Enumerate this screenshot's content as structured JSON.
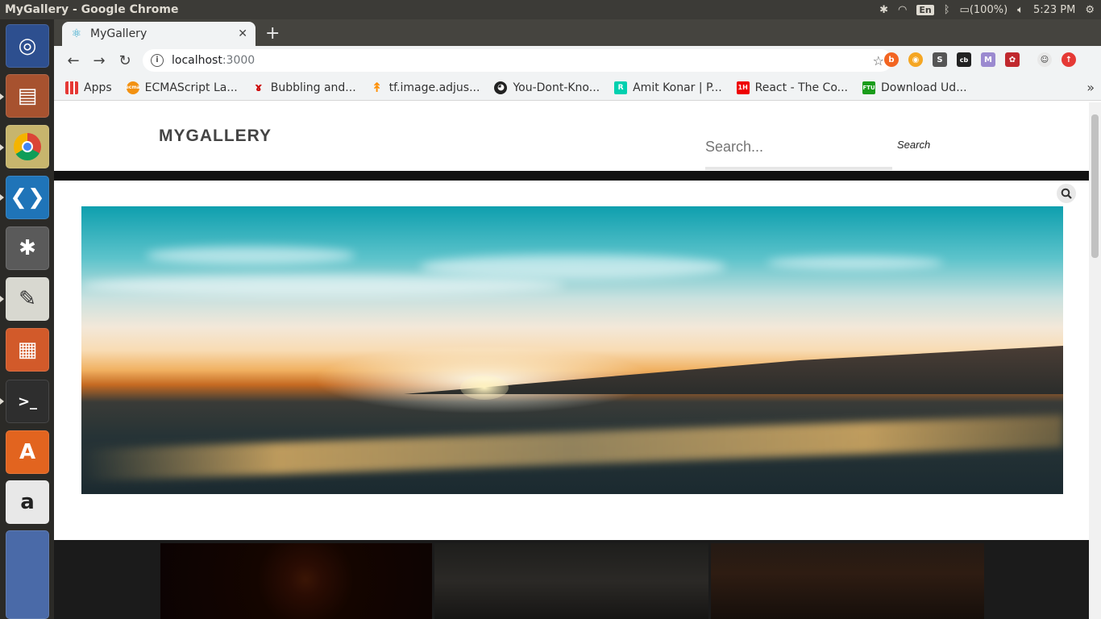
{
  "os": {
    "window_title": "MyGallery - Google Chrome",
    "keyboard_layout": "En",
    "battery": "(100%)",
    "clock": "5:23 PM"
  },
  "browser": {
    "tab": {
      "title": "MyGallery",
      "favicon": "react-icon"
    },
    "url": {
      "host": "localhost",
      "port": ":3000"
    },
    "bookmarks": [
      {
        "label": "Apps",
        "icon": "apps-grid-icon"
      },
      {
        "label": "ECMAScript La...",
        "icon": "ecma-icon"
      },
      {
        "label": "Bubbling and...",
        "icon": "person-icon"
      },
      {
        "label": "tf.image.adjus...",
        "icon": "tensorflow-icon"
      },
      {
        "label": "You-Dont-Kno...",
        "icon": "github-icon"
      },
      {
        "label": "Amit Konar | P...",
        "icon": "researchgate-icon"
      },
      {
        "label": "React - The Co...",
        "icon": "react-icon"
      },
      {
        "label": "Download Ud...",
        "icon": "ftu-icon"
      }
    ]
  },
  "site": {
    "brand": "MYGALLERY",
    "search_placeholder": "Search...",
    "search_button": "Search"
  },
  "colors": {
    "header_dark_bar": "#111111",
    "gallery_bg": "#1b1b1b",
    "ubuntu_panel": "#3c3b37"
  }
}
